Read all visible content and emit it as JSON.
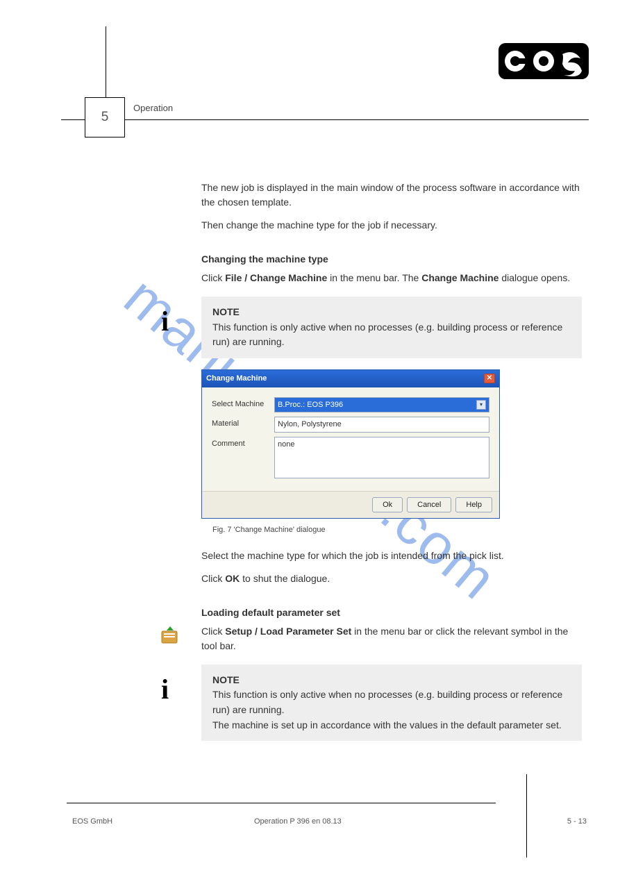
{
  "logo_text": "eos",
  "page_number": "5",
  "section_label": "Operation",
  "intro_p1": "The new job is displayed in the main window of the process software in accordance with the chosen template.",
  "intro_p2": "Then change the machine type for the job if necessary.",
  "heading_change_machine": "Changing the machine type",
  "change_p": "Click File / Change Machine in the menu bar. The Change Machine dialogue opens.",
  "note_label": "NOTE",
  "note_text": "This function is only active when no processes (e.g. building process or reference run) are running.",
  "dialog": {
    "title": "Change Machine",
    "labels": {
      "select": "Select Machine",
      "material": "Material",
      "comment": "Comment"
    },
    "values": {
      "select": "B.Proc.: EOS P396",
      "material": "Nylon, Polystyrene",
      "comment": "none"
    },
    "buttons": {
      "ok": "Ok",
      "cancel": "Cancel",
      "help": "Help"
    }
  },
  "fig_caption": "Fig. 7 'Change Machine' dialogue",
  "steps_p1": "Select the machine type for which the job is intended from the pick list.",
  "steps_p2_a": "Click ",
  "steps_p2_ok": "OK",
  "steps_p2_b": " to shut the dialogue.",
  "heading_param": "Loading default parameter set",
  "param_p": "Click Setup / Load Parameter Set in the menu bar or click the relevant symbol in the tool bar.",
  "note2_a": "This function is only active when no processes (e.g. building process or reference run) are running.",
  "note2_b": "The machine is set up in accordance with the values in the default parameter set.",
  "footer": {
    "left": "EOS GmbH",
    "mid": "Operation P 396 en 08.13",
    "right": "5 - 13"
  },
  "watermark": "manualshive.com"
}
